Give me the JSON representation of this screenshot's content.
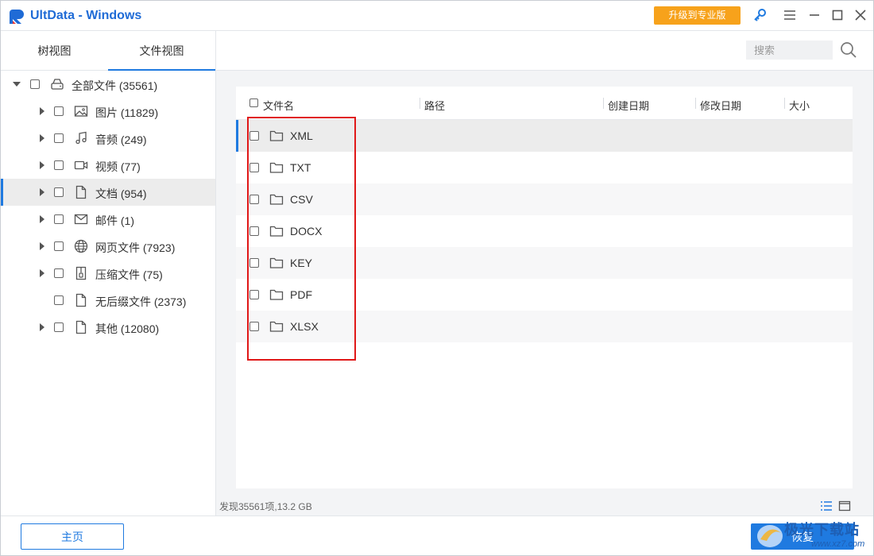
{
  "app": {
    "title": "UltData - Windows",
    "upgrade_label": "升级到专业版"
  },
  "colors": {
    "accent": "#1f7ae0",
    "upgrade": "#f7a21b",
    "highlight": "#e01818"
  },
  "sidebar": {
    "tabs": [
      {
        "label": "树视图"
      },
      {
        "label": "文件视图"
      }
    ],
    "tree": [
      {
        "label": "全部文件 (35561)",
        "icon": "drive-icon"
      },
      {
        "label": "图片 (11829)",
        "icon": "image-icon"
      },
      {
        "label": "音频 (249)",
        "icon": "music-icon"
      },
      {
        "label": "视频 (77)",
        "icon": "video-icon"
      },
      {
        "label": "文档 (954)",
        "icon": "document-icon"
      },
      {
        "label": "邮件 (1)",
        "icon": "mail-icon"
      },
      {
        "label": "网页文件 (7923)",
        "icon": "globe-icon"
      },
      {
        "label": "压缩文件 (75)",
        "icon": "archive-icon"
      },
      {
        "label": "无后缀文件 (2373)",
        "icon": "file-icon"
      },
      {
        "label": "其他 (12080)",
        "icon": "file-icon"
      }
    ]
  },
  "search": {
    "placeholder": "搜索"
  },
  "table": {
    "columns": [
      "文件名",
      "路径",
      "创建日期",
      "修改日期",
      "大小"
    ],
    "rows": [
      {
        "name": "XML"
      },
      {
        "name": "TXT"
      },
      {
        "name": "CSV"
      },
      {
        "name": "DOCX"
      },
      {
        "name": "KEY"
      },
      {
        "name": "PDF"
      },
      {
        "name": "XLSX"
      }
    ]
  },
  "status": {
    "text": "发现35561项,13.2 GB"
  },
  "footer": {
    "home_label": "主页",
    "recover_label": "恢复"
  },
  "watermark": {
    "text": "极光下载站",
    "url": "www.xz7.com"
  }
}
